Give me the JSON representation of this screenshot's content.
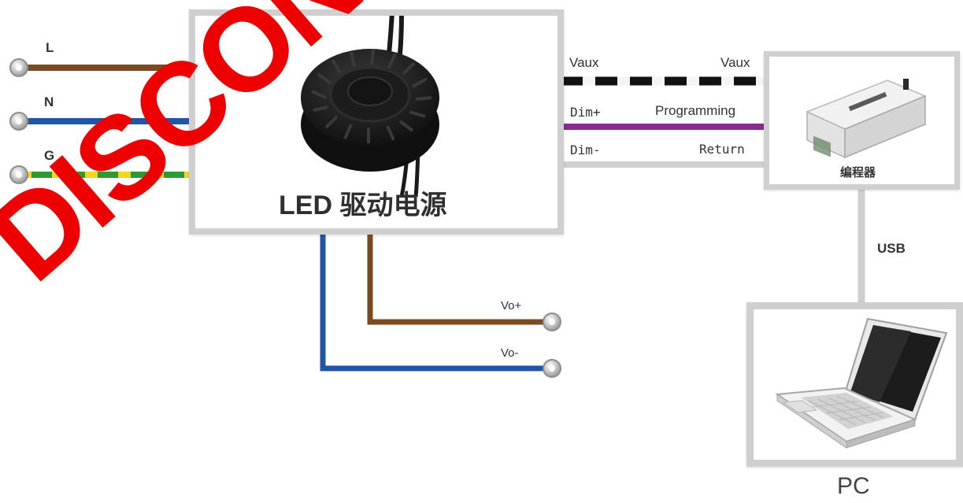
{
  "input_terminals": {
    "line": "L",
    "neutral": "N",
    "ground": "G"
  },
  "driver": {
    "title": "LED 驱动电源"
  },
  "signal_wires": {
    "left": {
      "vaux": "Vaux",
      "dim_plus": "Dim+",
      "dim_minus": "Dim-"
    },
    "right": {
      "vaux": "Vaux",
      "programming": "Programming",
      "return": "Return"
    }
  },
  "programmer": {
    "label": "编程器"
  },
  "usb_link": {
    "label": "USB"
  },
  "pc": {
    "label": "PC"
  },
  "outputs": {
    "vo_plus": "Vo+",
    "vo_minus": "Vo-"
  },
  "watermark": {
    "text": "DISCONTINUED"
  },
  "colors": {
    "line_wire": "#7a4a22",
    "neutral_wire": "#1f57a6",
    "ground_wire_a": "#f2d61a",
    "ground_wire_b": "#2f9a35",
    "dim_plus_wire": "#8a2a8c",
    "watermark": "#ee0000",
    "box_border": "#cfcfcf"
  }
}
